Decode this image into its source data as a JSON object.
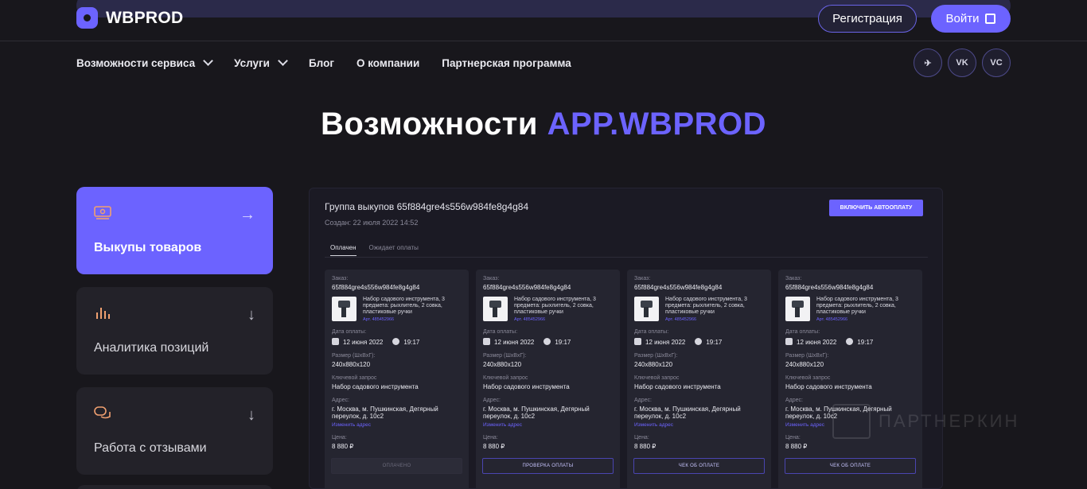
{
  "header": {
    "logo_text": "WBPROD",
    "register_label": "Регистрация",
    "login_label": "Войти"
  },
  "nav": {
    "items": [
      {
        "label": "Возможности сервиса",
        "has_dropdown": true
      },
      {
        "label": "Услуги",
        "has_dropdown": true
      },
      {
        "label": "Блог",
        "has_dropdown": false
      },
      {
        "label": "О компании",
        "has_dropdown": false
      },
      {
        "label": "Партнерская программа",
        "has_dropdown": false
      }
    ],
    "socials": [
      {
        "icon": "telegram-icon",
        "text": "✈"
      },
      {
        "icon": "vk-icon",
        "text": "VK"
      },
      {
        "icon": "vc-icon",
        "text": "VC"
      }
    ]
  },
  "hero": {
    "title_plain": "Возможности",
    "title_accent": "APP.WBPROD"
  },
  "features": [
    {
      "label": "Выкупы товаров",
      "icon": "money-icon",
      "arrow": "→",
      "active": true
    },
    {
      "label": "Аналитика позиций",
      "icon": "bar-chart-icon",
      "arrow": "↓",
      "active": false
    },
    {
      "label": "Работа с отзывами",
      "icon": "chat-icon",
      "arrow": "↓",
      "active": false
    }
  ],
  "panel": {
    "title": "Группа выкупов 65f884gre4s556w984fe8g4g84",
    "created": "Создан: 22 июля 2022 14:52",
    "autopay_label": "ВКЛЮЧИТЬ АВТООПЛАТУ",
    "tabs": [
      "Оплачен",
      "Ожидает оплаты"
    ],
    "orders": [
      {
        "order_label": "Заказ:",
        "order_id": "65f884gre4s556w984fe8g4g84",
        "product": "Набор садового инструмента, 3 предмета: рыхлитель, 2 совка, пластиковые ручки",
        "article": "Арт. 485452966",
        "pay_date_label": "Дата оплаты:",
        "date": "12 июня 2022",
        "time": "19:17",
        "size_label": "Размер (ШхВхГ):",
        "size": "240x880x120",
        "keyword_label": "Ключевой запрос",
        "keyword": "Набор садового инструмента",
        "address_label": "Адрес:",
        "address": "г. Москва, м. Пушкинская, Дегярный переулок, д. 10с2",
        "change_address": "Изменить адрес",
        "price_label": "Цена:",
        "price": "8 880 ₽",
        "button": "ОПЛАЧЕНО"
      },
      {
        "order_label": "Заказ:",
        "order_id": "65f884gre4s556w984fe8g4g84",
        "product": "Набор садового инструмента, 3 предмета: рыхлитель, 2 совка, пластиковые ручки",
        "article": "Арт. 485452966",
        "pay_date_label": "Дата оплаты:",
        "date": "12 июня 2022",
        "time": "19:17",
        "size_label": "Размер (ШхВхГ):",
        "size": "240x880x120",
        "keyword_label": "Ключевой запрос",
        "keyword": "Набор садового инструмента",
        "address_label": "Адрес:",
        "address": "г. Москва, м. Пушкинская, Дегярный переулок, д. 10с2",
        "change_address": "Изменить адрес",
        "price_label": "Цена:",
        "price": "8 880 ₽",
        "button": "ПРОВЕРКА ОПЛАТЫ"
      },
      {
        "order_label": "Заказ:",
        "order_id": "65f884gre4s556w984fe8g4g84",
        "product": "Набор садового инструмента, 3 предмета: рыхлитель, 2 совка, пластиковые ручки",
        "article": "Арт. 485452966",
        "pay_date_label": "Дата оплаты:",
        "date": "12 июня 2022",
        "time": "19:17",
        "size_label": "Размер (ШхВхГ):",
        "size": "240x880x120",
        "keyword_label": "Ключевой запрос",
        "keyword": "Набор садового инструмента",
        "address_label": "Адрес:",
        "address": "г. Москва, м. Пушкинская, Дегярный переулок, д. 10с2",
        "change_address": "Изменить адрес",
        "price_label": "Цена:",
        "price": "8 880 ₽",
        "button": "ЧЕК ОБ ОПЛАТЕ"
      },
      {
        "order_label": "Заказ:",
        "order_id": "65f884gre4s556w984fe8g4g84",
        "product": "Набор садового инструмента, 3 предмета: рыхлитель, 2 совка, пластиковые ручки",
        "article": "Арт. 485452966",
        "pay_date_label": "Дата оплаты:",
        "date": "12 июня 2022",
        "time": "19:17",
        "size_label": "Размер (ШхВхГ):",
        "size": "240x880x120",
        "keyword_label": "Ключевой запрос",
        "keyword": "Набор садового инструмента",
        "address_label": "Адрес:",
        "address": "г. Москва, м. Пушкинская, Дегярный переулок, д. 10с2",
        "change_address": "Изменить адрес",
        "price_label": "Цена:",
        "price": "8 880 ₽",
        "button": "ЧЕК ОБ ОПЛАТЕ"
      }
    ]
  },
  "watermark": "ПАРТНЕРКИН",
  "colors": {
    "accent": "#6c63ff",
    "background": "#18171c",
    "card": "#232229"
  }
}
